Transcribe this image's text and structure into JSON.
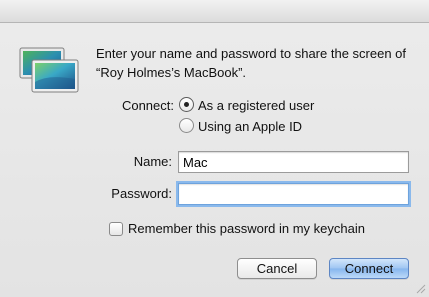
{
  "dialog": {
    "message": "Enter your name and password to share the screen of “Roy Holmes’s MacBook”.",
    "icon": "screen-sharing-app-icon"
  },
  "connect": {
    "label": "Connect:",
    "options": [
      {
        "label": "As a registered user",
        "selected": true
      },
      {
        "label": "Using an Apple ID",
        "selected": false
      }
    ]
  },
  "name": {
    "label": "Name:",
    "value": "Mac"
  },
  "password": {
    "label": "Password:",
    "value": ""
  },
  "remember": {
    "label": "Remember this password in my keychain",
    "checked": false
  },
  "buttons": {
    "cancel": "Cancel",
    "connect": "Connect"
  },
  "colors": {
    "focus_ring": "#8ab9ec",
    "default_button": "#9ec5f2"
  }
}
